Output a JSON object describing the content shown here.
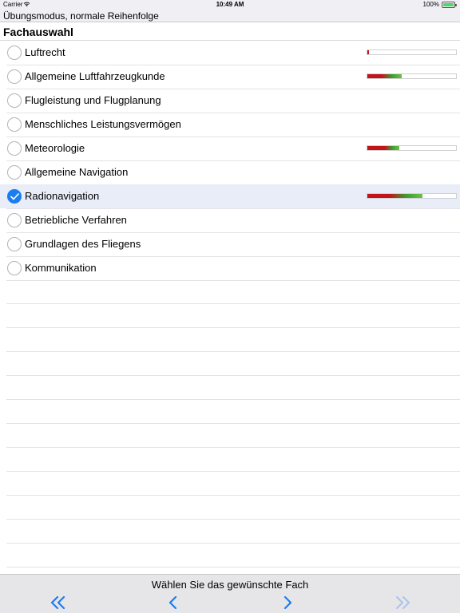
{
  "status_bar": {
    "carrier": "Carrier",
    "time": "10:49 AM",
    "battery": "100%"
  },
  "mode_title": "Übungsmodus, normale Reihenfolge",
  "section_title": "Fachauswahl",
  "subjects": [
    {
      "label": "Luftrecht",
      "selected": false,
      "progress_red": 0.02,
      "progress_green": 0.0
    },
    {
      "label": "Allgemeine Luftfahrzeugkunde",
      "selected": false,
      "progress_red": 0.16,
      "progress_green": 0.23
    },
    {
      "label": "Flugleistung und Flugplanung",
      "selected": false
    },
    {
      "label": "Menschliches Leistungsvermögen",
      "selected": false
    },
    {
      "label": "Meteorologie",
      "selected": false,
      "progress_red": 0.2,
      "progress_green": 0.16
    },
    {
      "label": "Allgemeine Navigation",
      "selected": false
    },
    {
      "label": "Radionavigation",
      "selected": true,
      "progress_red": 0.25,
      "progress_green": 0.37
    },
    {
      "label": "Betriebliche Verfahren",
      "selected": false
    },
    {
      "label": "Grundlagen des Fliegens",
      "selected": false
    },
    {
      "label": "Kommunikation",
      "selected": false
    }
  ],
  "bottom": {
    "prompt": "Wählen Sie das gewünschte Fach",
    "nav_icons": [
      "double-chevron-left-icon",
      "chevron-left-icon",
      "chevron-right-icon",
      "double-chevron-right-icon"
    ]
  },
  "colors": {
    "accent": "#1a7ef2",
    "selected_row": "#e8edf8",
    "progress_red": "#c3141a",
    "progress_green": "#6bc248",
    "disabled_nav": "#a8c4ec"
  }
}
